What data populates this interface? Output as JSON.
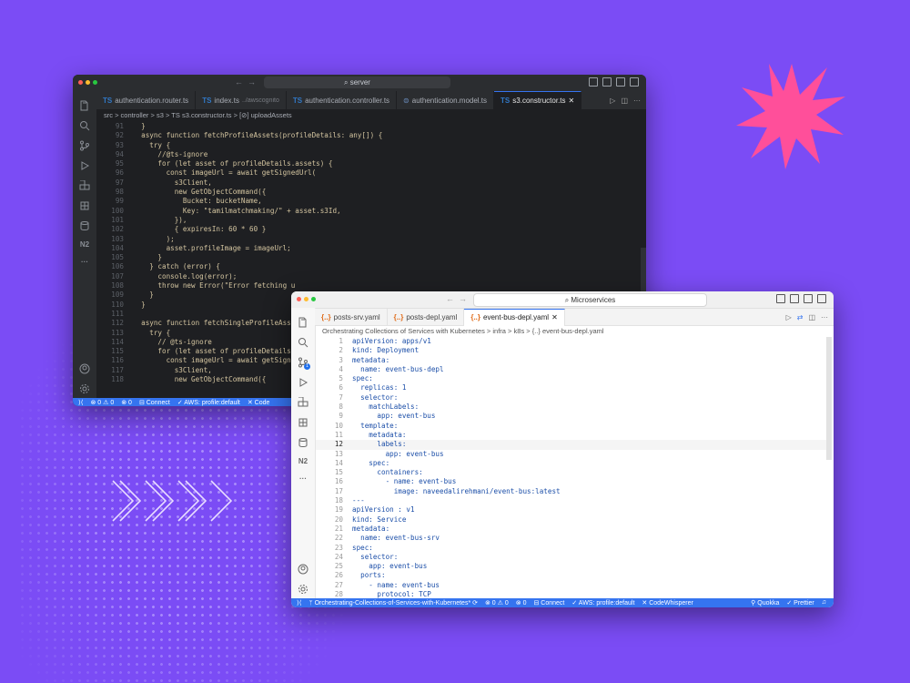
{
  "dark_window": {
    "search": "⌕ server",
    "tabs": [
      {
        "icon": "TS",
        "label": "authentication.router.ts",
        "sub": ""
      },
      {
        "icon": "TS",
        "label": "index.ts",
        "sub": "../awscognito"
      },
      {
        "icon": "TS",
        "label": "authentication.controller.ts",
        "sub": ""
      },
      {
        "icon": "⊜",
        "label": "authentication.model.ts",
        "sub": ""
      },
      {
        "icon": "TS",
        "label": "s3.constructor.ts",
        "sub": ""
      }
    ],
    "close_mark": "✕",
    "breadcrumb": "src > controller > s3 > TS s3.constructor.ts > [⊘] uploadAssets",
    "code": [
      {
        "n": "91",
        "t": "  }"
      },
      {
        "n": "92",
        "t": "  async function fetchProfileAssets(profileDetails: any[]) {"
      },
      {
        "n": "93",
        "t": "    try {"
      },
      {
        "n": "94",
        "t": "      //@ts-ignore"
      },
      {
        "n": "95",
        "t": "      for (let asset of profileDetails.assets) {"
      },
      {
        "n": "96",
        "t": "        const imageUrl = await getSignedUrl("
      },
      {
        "n": "97",
        "t": "          s3Client,"
      },
      {
        "n": "98",
        "t": "          new GetObjectCommand({"
      },
      {
        "n": "99",
        "t": "            Bucket: bucketName,"
      },
      {
        "n": "100",
        "t": "            Key: \"tamilmatchmaking/\" + asset.s3Id,"
      },
      {
        "n": "101",
        "t": "          }),"
      },
      {
        "n": "102",
        "t": "          { expiresIn: 60 * 60 }"
      },
      {
        "n": "103",
        "t": "        );"
      },
      {
        "n": "104",
        "t": "        asset.profileImage = imageUrl;"
      },
      {
        "n": "105",
        "t": "      }"
      },
      {
        "n": "106",
        "t": "    } catch (error) {"
      },
      {
        "n": "107",
        "t": "      console.log(error);"
      },
      {
        "n": "108",
        "t": "      throw new Error(\"Error fetching u"
      },
      {
        "n": "109",
        "t": "    }"
      },
      {
        "n": "110",
        "t": "  }"
      },
      {
        "n": "111",
        "t": ""
      },
      {
        "n": "112",
        "t": "  async function fetchSingleProfileAsse"
      },
      {
        "n": "113",
        "t": "    try {"
      },
      {
        "n": "114",
        "t": "      // @ts-ignore"
      },
      {
        "n": "115",
        "t": "      for (let asset of profileDetails.?"
      },
      {
        "n": "116",
        "t": "        const imageUrl = await getSignec"
      },
      {
        "n": "117",
        "t": "          s3Client,"
      },
      {
        "n": "118",
        "t": "          new GetObjectCommand({"
      }
    ],
    "status": [
      "⊗ 0 ⚠ 0",
      "⊗ 0",
      "⊟ Connect",
      "✓ AWS: profile:default",
      "✕ Code"
    ]
  },
  "light_window": {
    "search": "⌕ Microservices",
    "tabs": [
      {
        "icon": "{..}",
        "label": "posts-srv.yaml"
      },
      {
        "icon": "{..}",
        "label": "posts-depl.yaml"
      },
      {
        "icon": "{..}",
        "label": "event-bus-depl.yaml"
      }
    ],
    "close_mark": "✕",
    "breadcrumb": "Orchestrating Collections of Services with Kubernetes > infra > k8s > {..} event-bus-depl.yaml",
    "code": [
      {
        "n": "1",
        "t": "apiVersion: apps/v1"
      },
      {
        "n": "2",
        "t": "kind: Deployment"
      },
      {
        "n": "3",
        "t": "metadata:"
      },
      {
        "n": "4",
        "t": "  name: event-bus-depl"
      },
      {
        "n": "5",
        "t": "spec:"
      },
      {
        "n": "6",
        "t": "  replicas: 1"
      },
      {
        "n": "7",
        "t": "  selector:"
      },
      {
        "n": "8",
        "t": "    matchLabels:"
      },
      {
        "n": "9",
        "t": "      app: event-bus"
      },
      {
        "n": "10",
        "t": "  template:"
      },
      {
        "n": "11",
        "t": "    metadata:"
      },
      {
        "n": "12",
        "t": "      labels:"
      },
      {
        "n": "13",
        "t": "        app: event-bus"
      },
      {
        "n": "14",
        "t": "    spec:"
      },
      {
        "n": "15",
        "t": "      containers:"
      },
      {
        "n": "16",
        "t": "        - name: event-bus"
      },
      {
        "n": "17",
        "t": "          image: naveedalirehmani/event-bus:latest"
      },
      {
        "n": "18",
        "t": "---"
      },
      {
        "n": "19",
        "t": "apiVersion : v1"
      },
      {
        "n": "20",
        "t": "kind: Service"
      },
      {
        "n": "21",
        "t": "metadata:"
      },
      {
        "n": "22",
        "t": "  name: event-bus-srv"
      },
      {
        "n": "23",
        "t": "spec:"
      },
      {
        "n": "24",
        "t": "  selector:"
      },
      {
        "n": "25",
        "t": "    app: event-bus"
      },
      {
        "n": "26",
        "t": "  ports:"
      },
      {
        "n": "27",
        "t": "    - name: event-bus"
      },
      {
        "n": "28",
        "t": "      protocol: TCP"
      }
    ],
    "current_line": "12",
    "status_left": [
      "ᛘ Orchestrating-Collections-of-Services-with-Kubernetes* ⟳",
      "⊗ 0 ⚠ 0",
      "⊗ 0",
      "⊟ Connect",
      "✓ AWS: profile:default",
      "✕ CodeWhisperer"
    ],
    "status_right": [
      "⚲ Quokka",
      "✓ Prettier",
      "♫"
    ]
  },
  "colors": {
    "background": "#7b4cf5",
    "splat": "#ff4f9a",
    "status_bar": "#3574f0"
  }
}
